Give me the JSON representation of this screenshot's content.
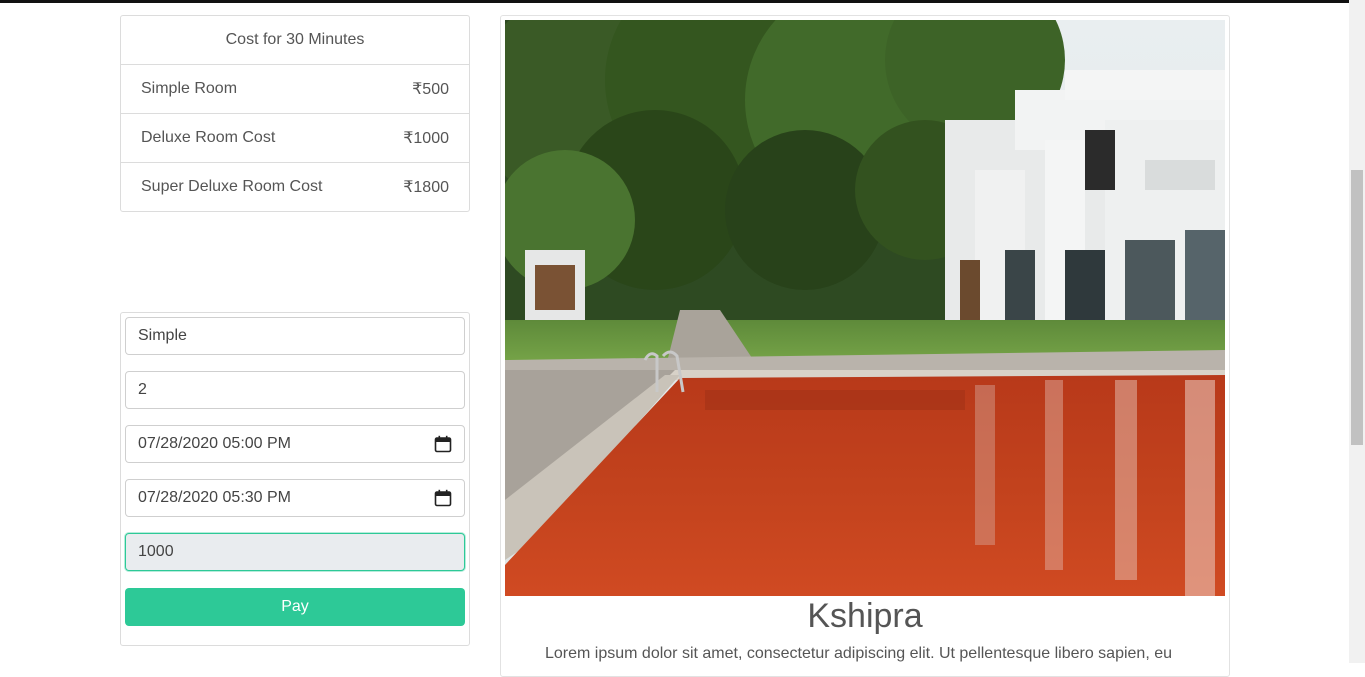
{
  "cost_table": {
    "header": "Cost for 30 Minutes",
    "rows": [
      {
        "label": "Simple Room",
        "price": "₹500"
      },
      {
        "label": "Deluxe Room Cost",
        "price": "₹1000"
      },
      {
        "label": "Super Deluxe Room Cost",
        "price": "₹1800"
      }
    ]
  },
  "form": {
    "room_type": "Simple",
    "guests": "2",
    "check_in": "07/28/2020 05:00 PM",
    "check_out": "07/28/2020 05:30 PM",
    "amount": "1000",
    "pay_label": "Pay"
  },
  "hotel": {
    "name": "Kshipra",
    "description": "Lorem ipsum dolor sit amet, consectetur adipiscing elit. Ut pellentesque libero sapien, eu"
  },
  "colors": {
    "accent": "#2dc997",
    "border": "#dcdcdc"
  },
  "icons": {
    "calendar": "calendar-icon"
  }
}
